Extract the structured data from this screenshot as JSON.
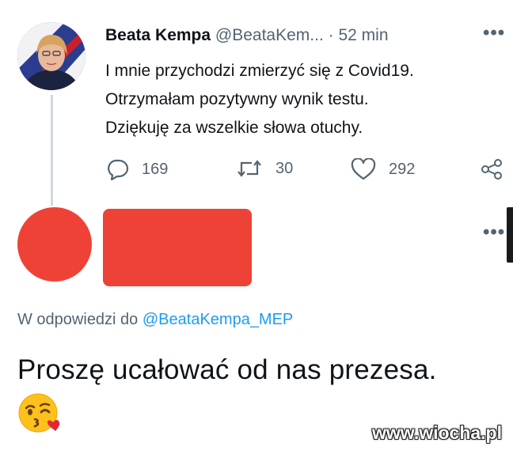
{
  "tweet": {
    "author_name": "Beata Kempa",
    "author_handle": "@BeataKem...",
    "separator": "·",
    "time": "52 min",
    "more_label": "•••",
    "lines": [
      "I mnie przychodzi zmierzyć się z Covid19.",
      "Otrzymałam pozytywny wynik testu.",
      "Dziękuję za wszelkie słowa otuchy."
    ],
    "actions": {
      "reply_count": "169",
      "retweet_count": "30",
      "like_count": "292"
    }
  },
  "reply": {
    "more_label": "•••",
    "reply_to_prefix": "W odpowiedzi do",
    "reply_to_handle": "@BeataKempa_MEP",
    "text": "Proszę ucałować od nas prezesa.",
    "emoji": "face-throwing-a-kiss"
  },
  "watermark": "www.wiocha.pl",
  "colors": {
    "text_primary": "#0f1419",
    "text_secondary": "#536471",
    "link": "#1d9bf0",
    "redaction": "#ef4236",
    "thread_line": "#cfd9de"
  }
}
